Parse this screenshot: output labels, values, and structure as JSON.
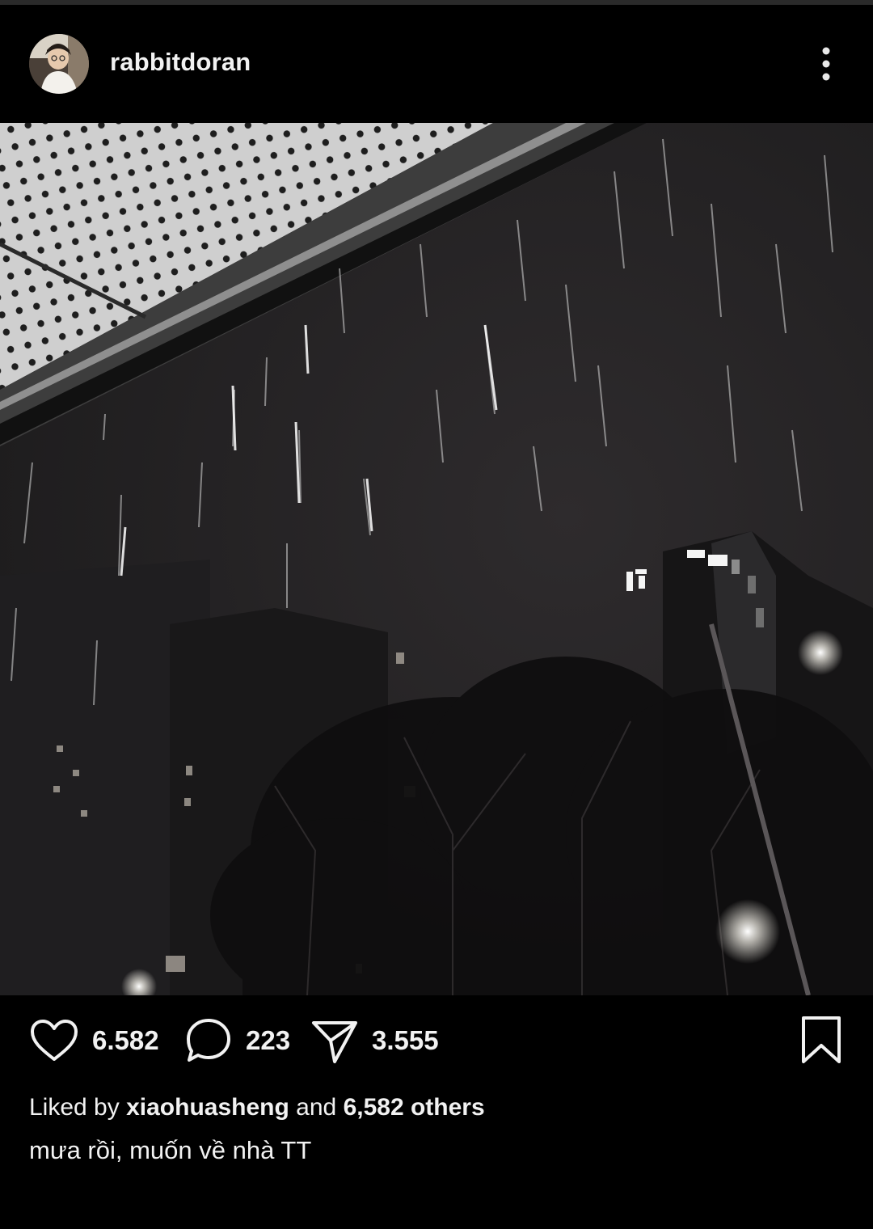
{
  "post": {
    "username": "rabbitdoran",
    "menu_icon": "more-vertical-icon",
    "photo_alt": "rain at night",
    "actions": {
      "likes_count": "6.582",
      "comments_count": "223",
      "shares_count": "3.555",
      "like_icon": "heart-icon",
      "comment_icon": "comment-icon",
      "share_icon": "send-icon",
      "save_icon": "bookmark-icon"
    },
    "liked_by": {
      "prefix": "Liked by",
      "user": "xiaohuasheng",
      "conjunction": "and",
      "others": "6,582 others"
    },
    "caption": "mưa rồi, muốn về nhà TT"
  },
  "colors": {
    "background": "#000000",
    "text": "#f2f2f2"
  }
}
